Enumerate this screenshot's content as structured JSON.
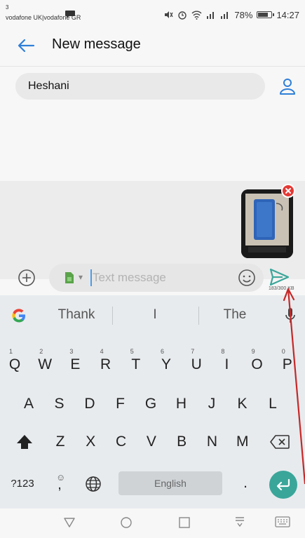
{
  "status_bar": {
    "slot": "3",
    "carrier": "vodafone UK|vodafone GR",
    "battery": "78%",
    "time": "14:27"
  },
  "header": {
    "title": "New message"
  },
  "recipient": {
    "name": "Heshani"
  },
  "composer": {
    "placeholder": "Text message",
    "size_indicator": "183/300 KB"
  },
  "keyboard": {
    "suggestions": [
      "Thank",
      "I",
      "The"
    ],
    "row1": [
      "Q",
      "W",
      "E",
      "R",
      "T",
      "Y",
      "U",
      "I",
      "O",
      "P"
    ],
    "row1_hints": [
      "1",
      "2",
      "3",
      "4",
      "5",
      "6",
      "7",
      "8",
      "9",
      "0"
    ],
    "row2": [
      "A",
      "S",
      "D",
      "F",
      "G",
      "H",
      "J",
      "K",
      "L"
    ],
    "row3": [
      "Z",
      "X",
      "C",
      "V",
      "B",
      "N",
      "M"
    ],
    "symbols_label": "?123",
    "comma_label": ",",
    "comma_hint": "☺",
    "space_label": "English",
    "period_label": "."
  },
  "icons": {
    "back": "back-arrow-icon",
    "contact": "person-icon",
    "add": "plus-circle-icon",
    "sim": "sim-card-icon",
    "emoji": "smiley-icon",
    "send": "send-icon",
    "mic": "mic-icon",
    "globe": "globe-icon",
    "shift": "shift-icon",
    "backspace": "backspace-icon",
    "enter": "enter-icon"
  },
  "colors": {
    "accent_blue": "#2f7fd8",
    "send_green": "#3aa69a",
    "annotation_red": "#c62828"
  }
}
